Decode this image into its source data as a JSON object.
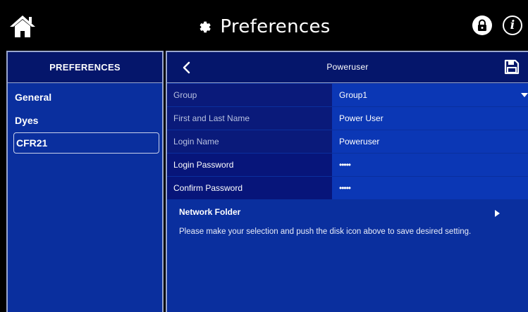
{
  "topbar": {
    "title": "Preferences",
    "icons": [
      "home-icon",
      "gear-icon",
      "lock-icon",
      "info-icon"
    ]
  },
  "left_panel": {
    "header": "PREFERENCES",
    "items": [
      {
        "label": "General",
        "active": false
      },
      {
        "label": "Dyes",
        "active": false
      },
      {
        "label": "CFR21",
        "active": true
      }
    ]
  },
  "right_panel": {
    "title": "Poweruser",
    "fields": [
      {
        "label": "Group",
        "value": "Group1"
      },
      {
        "label": "First and Last Name",
        "value": "Power User"
      },
      {
        "label": "Login Name",
        "value": "Poweruser"
      },
      {
        "label": "Login Password",
        "value": "•••••"
      },
      {
        "label": "Confirm Password",
        "value": "•••••"
      }
    ],
    "network_folder": "Network Folder",
    "hint": "Please make your selection and push the disk icon above to save desired setting."
  },
  "colors": {
    "panel_blue": "#0a2f9e",
    "header_navy": "#05166b",
    "value_blue": "#0b37b5"
  }
}
